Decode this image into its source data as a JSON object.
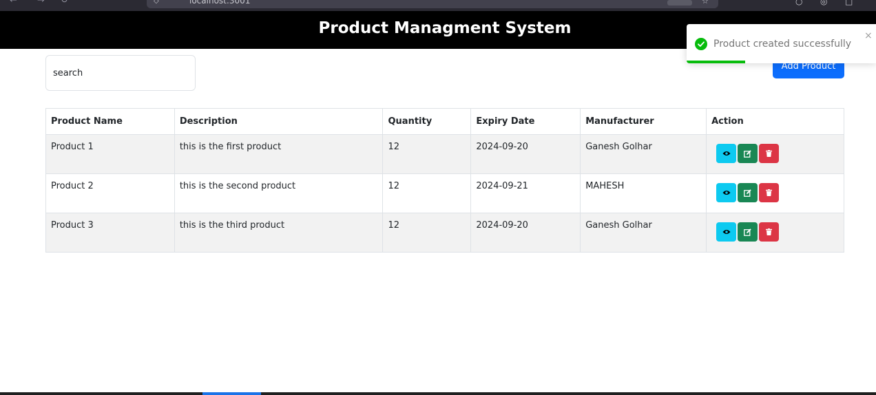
{
  "browser": {
    "url": "localhost:3001"
  },
  "header": {
    "title": "Product Managment System"
  },
  "search": {
    "placeholder": "search"
  },
  "toolbar": {
    "add_label": "Add Product"
  },
  "table": {
    "columns": [
      "Product Name",
      "Description",
      "Quantity",
      "Expiry Date",
      "Manufacturer",
      "Action"
    ],
    "rows": [
      {
        "name": "Product 1",
        "description": "this is the first product",
        "quantity": "12",
        "expiry": "2024-09-20",
        "manufacturer": "Ganesh Golhar"
      },
      {
        "name": "Product 2",
        "description": "this is the second product",
        "quantity": "12",
        "expiry": "2024-09-21",
        "manufacturer": "MAHESH"
      },
      {
        "name": "Product 3",
        "description": "this is the third product",
        "quantity": "12",
        "expiry": "2024-09-20",
        "manufacturer": "Ganesh Golhar"
      }
    ],
    "action_icons": [
      "eye-icon",
      "edit-icon",
      "trash-icon"
    ]
  },
  "toast": {
    "message": "Product created successfully",
    "close_glyph": "×",
    "progress": 0.31,
    "status_color": "#07bc0c"
  },
  "colors": {
    "header_bg": "#000000",
    "primary": "#0d6efd",
    "view": "#0dcaf0",
    "edit": "#198754",
    "delete": "#dc3545"
  }
}
